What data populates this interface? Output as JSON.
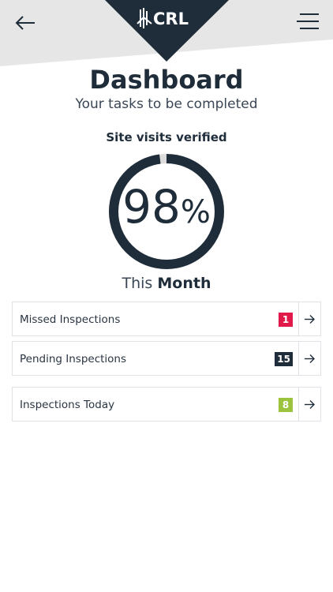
{
  "header": {
    "logo_text": "CRL",
    "back_icon": "arrow-left-icon",
    "menu_icon": "hamburger-menu-icon"
  },
  "page": {
    "title": "Dashboard",
    "subtitle": "Your tasks to be completed"
  },
  "gauge": {
    "label": "Site visits verified",
    "value": "98",
    "unit": "%",
    "fraction": 0.98,
    "period_prefix": "This",
    "period_bold": "Month"
  },
  "inspections": [
    {
      "label": "Missed Inspections",
      "count": "1",
      "color": "#e0194a"
    },
    {
      "label": "Pending Inspections",
      "count": "15",
      "color": "#1f2d3a"
    },
    {
      "label": "Inspections Today",
      "count": "8",
      "color": "#9cc33e"
    }
  ],
  "colors": {
    "brand_dark": "#1f2d3a",
    "header_grey": "#e6e6e6",
    "gauge_track": "#dcdcdc"
  }
}
